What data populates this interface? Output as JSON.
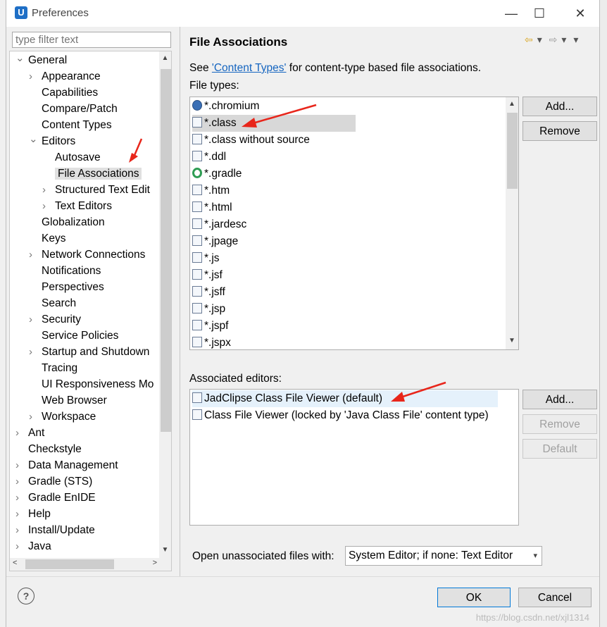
{
  "window": {
    "title": "Preferences",
    "app_icon": "U",
    "min": "—",
    "max": "☐",
    "close": "✕"
  },
  "filter_placeholder": "type filter text",
  "tree": [
    {
      "label": "General",
      "level": 0,
      "arrow": "v"
    },
    {
      "label": "Appearance",
      "level": 1,
      "arrow": ">"
    },
    {
      "label": "Capabilities",
      "level": 1,
      "arrow": ""
    },
    {
      "label": "Compare/Patch",
      "level": 1,
      "arrow": ""
    },
    {
      "label": "Content Types",
      "level": 1,
      "arrow": ""
    },
    {
      "label": "Editors",
      "level": 1,
      "arrow": "v"
    },
    {
      "label": "Autosave",
      "level": 2,
      "arrow": ""
    },
    {
      "label": "File Associations",
      "level": 2,
      "arrow": "",
      "selected": true
    },
    {
      "label": "Structured Text Edit",
      "level": 2,
      "arrow": ">"
    },
    {
      "label": "Text Editors",
      "level": 2,
      "arrow": ">"
    },
    {
      "label": "Globalization",
      "level": 1,
      "arrow": ""
    },
    {
      "label": "Keys",
      "level": 1,
      "arrow": ""
    },
    {
      "label": "Network Connections",
      "level": 1,
      "arrow": ">"
    },
    {
      "label": "Notifications",
      "level": 1,
      "arrow": ""
    },
    {
      "label": "Perspectives",
      "level": 1,
      "arrow": ""
    },
    {
      "label": "Search",
      "level": 1,
      "arrow": ""
    },
    {
      "label": "Security",
      "level": 1,
      "arrow": ">"
    },
    {
      "label": "Service Policies",
      "level": 1,
      "arrow": ""
    },
    {
      "label": "Startup and Shutdown",
      "level": 1,
      "arrow": ">"
    },
    {
      "label": "Tracing",
      "level": 1,
      "arrow": ""
    },
    {
      "label": "UI Responsiveness Mo",
      "level": 1,
      "arrow": ""
    },
    {
      "label": "Web Browser",
      "level": 1,
      "arrow": ""
    },
    {
      "label": "Workspace",
      "level": 1,
      "arrow": ">"
    },
    {
      "label": "Ant",
      "level": 0,
      "arrow": ">"
    },
    {
      "label": "Checkstyle",
      "level": 0,
      "arrow": ""
    },
    {
      "label": "Data Management",
      "level": 0,
      "arrow": ">"
    },
    {
      "label": "Gradle (STS)",
      "level": 0,
      "arrow": ">"
    },
    {
      "label": "Gradle EnIDE",
      "level": 0,
      "arrow": ">"
    },
    {
      "label": "Help",
      "level": 0,
      "arrow": ">"
    },
    {
      "label": "Install/Update",
      "level": 0,
      "arrow": ">"
    },
    {
      "label": "Java",
      "level": 0,
      "arrow": ">"
    }
  ],
  "page": {
    "title": "File Associations",
    "see_prefix": "See ",
    "see_link": "'Content Types'",
    "see_suffix": " for content-type based file associations.",
    "file_types_label": "File types:",
    "file_types": [
      {
        "label": "*.chromium",
        "icon": "chromium-icon"
      },
      {
        "label": "*.class",
        "icon": "class-file-icon",
        "selected": true
      },
      {
        "label": "*.class without source",
        "icon": "class-file-icon"
      },
      {
        "label": "*.ddl",
        "icon": "ddl-file-icon"
      },
      {
        "label": "*.gradle",
        "icon": "gradle-icon"
      },
      {
        "label": "*.htm",
        "icon": "html-file-icon"
      },
      {
        "label": "*.html",
        "icon": "html-file-icon"
      },
      {
        "label": "*.jardesc",
        "icon": "jardesc-file-icon"
      },
      {
        "label": "*.jpage",
        "icon": "jpage-file-icon"
      },
      {
        "label": "*.js",
        "icon": "js-file-icon"
      },
      {
        "label": "*.jsf",
        "icon": "jsf-file-icon"
      },
      {
        "label": "*.jsff",
        "icon": "jsf-file-icon"
      },
      {
        "label": "*.jsp",
        "icon": "jsp-file-icon"
      },
      {
        "label": "*.jspf",
        "icon": "jsp-file-icon"
      },
      {
        "label": "*.jspx",
        "icon": "jsp-file-icon"
      }
    ],
    "file_add": "Add...",
    "file_remove": "Remove",
    "assoc_label": "Associated editors:",
    "assoc_editors": [
      {
        "label": "JadClipse Class File Viewer (default)",
        "highlight": true
      },
      {
        "label": "Class File Viewer (locked by 'Java Class File' content type)"
      }
    ],
    "assoc_add": "Add...",
    "assoc_remove": "Remove",
    "assoc_default": "Default",
    "open_with_label": "Open unassociated files with:",
    "open_with_value": "System Editor; if none: Text Editor"
  },
  "footer": {
    "ok": "OK",
    "cancel": "Cancel",
    "help": "?"
  },
  "watermark": "https://blog.csdn.net/xjl1314",
  "colors": {
    "accent": "#0078d7",
    "link": "#1565c0",
    "annotation_arrow": "#e8261b"
  }
}
